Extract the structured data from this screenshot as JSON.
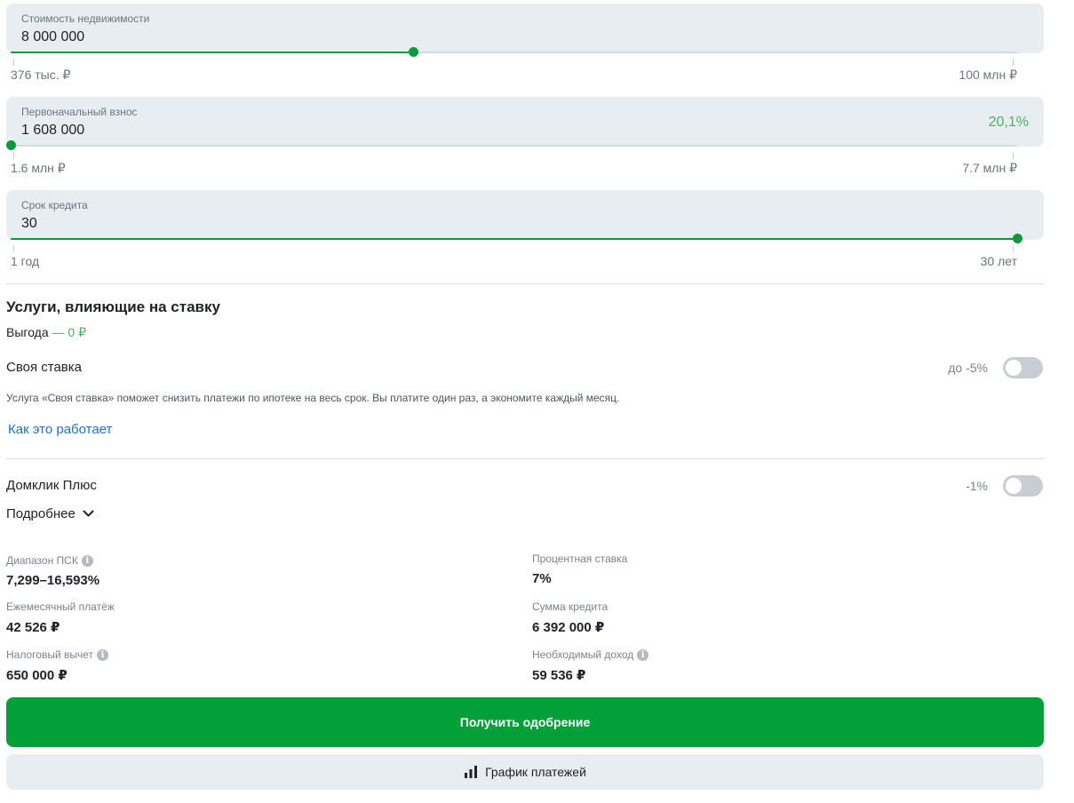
{
  "property": {
    "label": "Стоимость недвижимости",
    "value": "8 000 000",
    "min_label": "376 тыс. ₽",
    "max_label": "100 млн ₽",
    "slider_fraction": 0.4
  },
  "down_payment": {
    "label": "Первоначальный взнос",
    "value": "1 608 000",
    "percent": "20,1%",
    "min_label": "1.6 млн ₽",
    "max_label": "7.7 млн ₽",
    "slider_fraction": 0
  },
  "term": {
    "label": "Срок кредита",
    "value": "30",
    "min_label": "1 год",
    "max_label": "30 лет",
    "slider_fraction": 1
  },
  "services": {
    "title": "Услуги, влияющие на ставку",
    "benefit_label": "Выгода",
    "benefit_value": "— 0 ₽",
    "own_rate": {
      "name": "Своя ставка",
      "rate": "до -5%",
      "enabled": false,
      "description": "Услуга «Своя ставка» поможет снизить платежи по ипотеке на весь срок. Вы платите один раз, а экономите каждый месяц.",
      "link": "Как это работает"
    },
    "domclick_plus": {
      "name": "Домклик Плюс",
      "rate": "-1%",
      "enabled": false,
      "more_label": "Подробнее"
    }
  },
  "stats": {
    "psk_label": "Диапазон ПСК",
    "psk_value": "7,299–16,593%",
    "rate_label": "Процентная ставка",
    "rate_value": "7%",
    "monthly_label": "Ежемесячный платёж",
    "monthly_value": "42 526 ₽",
    "loan_label": "Сумма кредита",
    "loan_value": "6 392 000 ₽",
    "tax_label": "Налоговый вычет",
    "tax_value": "650 000 ₽",
    "income_label": "Необходимый доход",
    "income_value": "59 536 ₽"
  },
  "actions": {
    "approve": "Получить одобрение",
    "schedule": "График платежей"
  },
  "colors": {
    "accent": "#03a03a",
    "slider": "#0b9a3b",
    "positive_text": "#4caf67",
    "link": "#1f6fd1",
    "field_bg": "#e8edf2"
  }
}
